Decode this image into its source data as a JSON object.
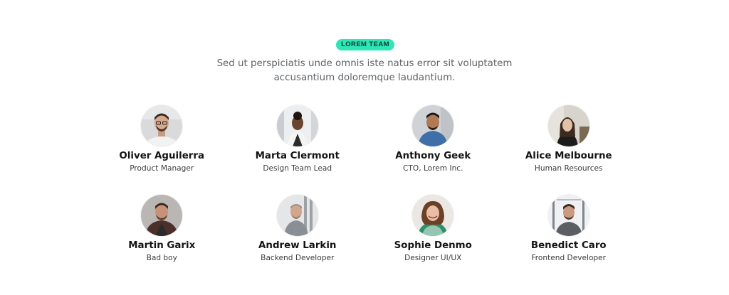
{
  "section": {
    "badge": "LOREM TEAM",
    "intro": "Sed ut perspiciatis unde omnis iste natus error sit voluptatem accusantium doloremque laudantium."
  },
  "colors": {
    "badge_bg": "#2ee6b6",
    "text_primary": "#141414",
    "text_muted": "#5f6469"
  },
  "members": [
    {
      "name": "Oliver Aguilerra",
      "role": "Product Manager",
      "avatar": "avatar-photo"
    },
    {
      "name": "Marta Clermont",
      "role": "Design Team Lead",
      "avatar": "avatar-photo"
    },
    {
      "name": "Anthony Geek",
      "role": "CTO, Lorem Inc.",
      "avatar": "avatar-photo"
    },
    {
      "name": "Alice Melbourne",
      "role": "Human Resources",
      "avatar": "avatar-photo"
    },
    {
      "name": "Martin Garix",
      "role": "Bad boy",
      "avatar": "avatar-photo"
    },
    {
      "name": "Andrew Larkin",
      "role": "Backend Developer",
      "avatar": "avatar-photo"
    },
    {
      "name": "Sophie Denmo",
      "role": "Designer UI/UX",
      "avatar": "avatar-photo"
    },
    {
      "name": "Benedict Caro",
      "role": "Frontend Developer",
      "avatar": "avatar-photo"
    }
  ]
}
